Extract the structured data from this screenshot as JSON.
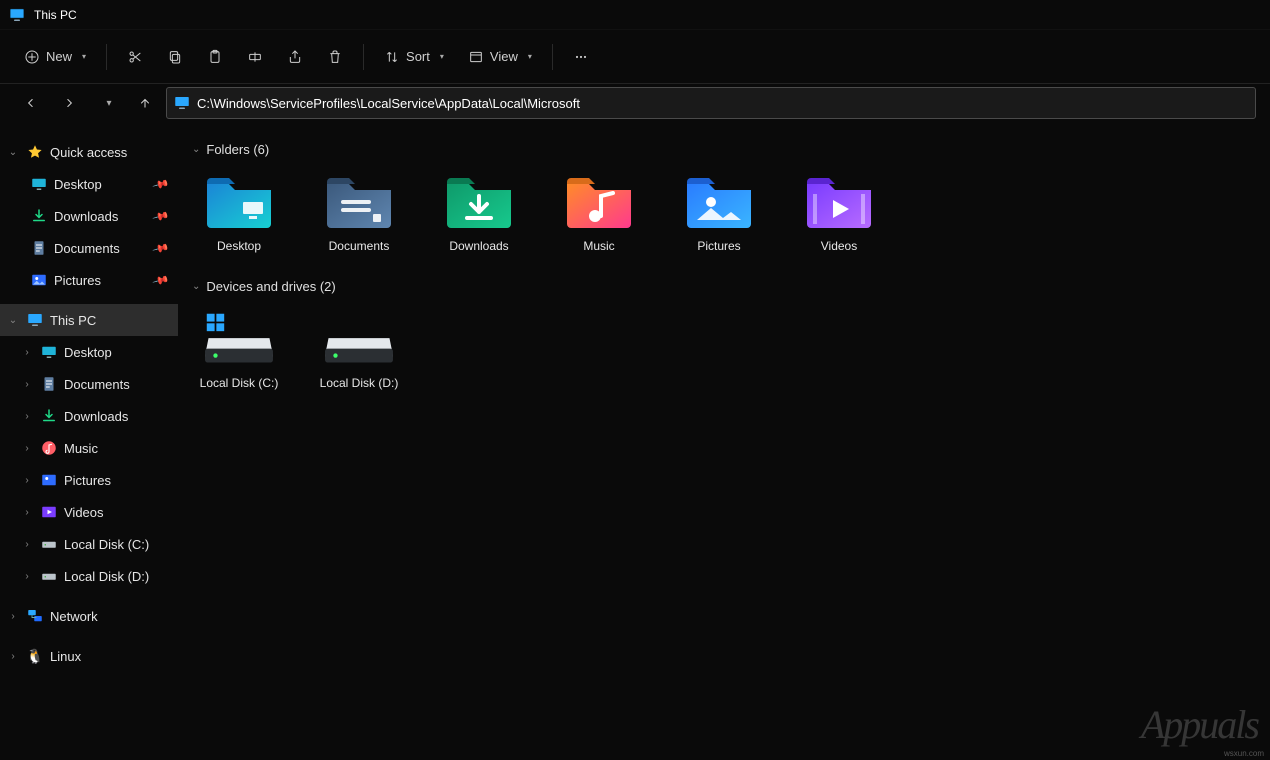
{
  "window": {
    "title": "This PC"
  },
  "toolbar": {
    "new_label": "New",
    "sort_label": "Sort",
    "view_label": "View"
  },
  "address": {
    "path": "C:\\Windows\\ServiceProfiles\\LocalService\\AppData\\Local\\Microsoft"
  },
  "sidebar": {
    "quick_access": {
      "label": "Quick access",
      "items": [
        {
          "label": "Desktop",
          "icon": "desktop",
          "pinned": true
        },
        {
          "label": "Downloads",
          "icon": "downloads",
          "pinned": true
        },
        {
          "label": "Documents",
          "icon": "documents",
          "pinned": true
        },
        {
          "label": "Pictures",
          "icon": "pictures",
          "pinned": true
        }
      ]
    },
    "this_pc": {
      "label": "This PC",
      "items": [
        {
          "label": "Desktop",
          "icon": "desktop"
        },
        {
          "label": "Documents",
          "icon": "documents"
        },
        {
          "label": "Downloads",
          "icon": "downloads"
        },
        {
          "label": "Music",
          "icon": "music"
        },
        {
          "label": "Pictures",
          "icon": "pictures"
        },
        {
          "label": "Videos",
          "icon": "videos"
        },
        {
          "label": "Local Disk (C:)",
          "icon": "drive"
        },
        {
          "label": "Local Disk (D:)",
          "icon": "drive"
        }
      ]
    },
    "network": {
      "label": "Network"
    },
    "linux": {
      "label": "Linux"
    }
  },
  "content": {
    "folders_header": "Folders (6)",
    "drives_header": "Devices and drives (2)",
    "folders": [
      {
        "label": "Desktop",
        "kind": "desktop"
      },
      {
        "label": "Documents",
        "kind": "documents"
      },
      {
        "label": "Downloads",
        "kind": "downloads"
      },
      {
        "label": "Music",
        "kind": "music"
      },
      {
        "label": "Pictures",
        "kind": "pictures"
      },
      {
        "label": "Videos",
        "kind": "videos"
      }
    ],
    "drives": [
      {
        "label": "Local Disk (C:)",
        "has_windows_logo": true
      },
      {
        "label": "Local Disk (D:)",
        "has_windows_logo": false
      }
    ]
  },
  "watermark": {
    "text": "Appuals",
    "site": "wsxun.com"
  }
}
